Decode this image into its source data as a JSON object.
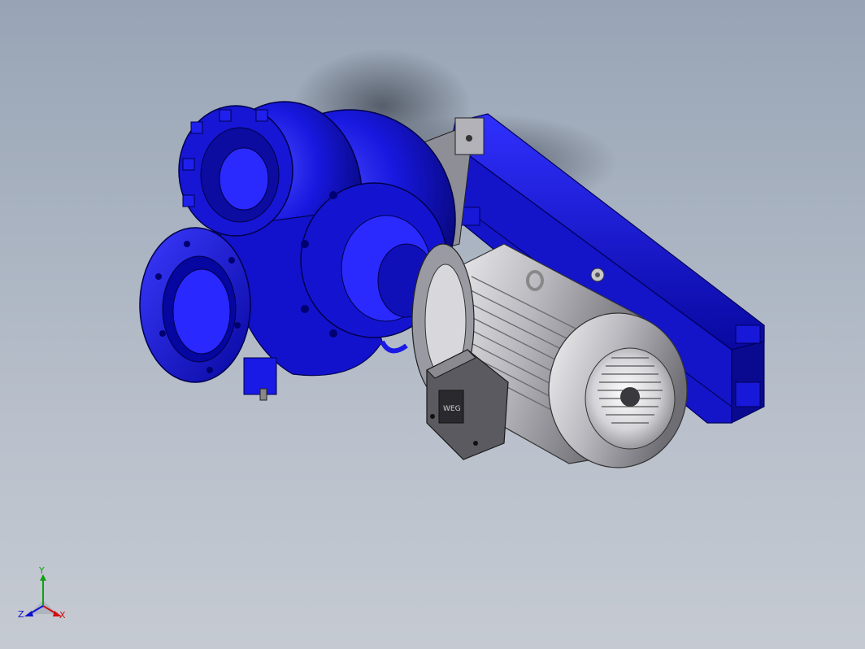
{
  "viewport": {
    "background_top": "#98a4b5",
    "background_bottom": "#c5cad2"
  },
  "model": {
    "pump_color": "#1a1ae6",
    "pump_shadow": "#0a0a8a",
    "motor_color": "#c8c8cc",
    "motor_dark": "#4a4a4e",
    "frame_color": "#2222dd",
    "bracket_color": "#9a9aa0",
    "terminal_box_label": "WEG"
  },
  "triad": {
    "x_label": "X",
    "y_label": "Y",
    "z_label": "Z",
    "x_color": "#d01010",
    "y_color": "#10a010",
    "z_color": "#1010d0"
  }
}
